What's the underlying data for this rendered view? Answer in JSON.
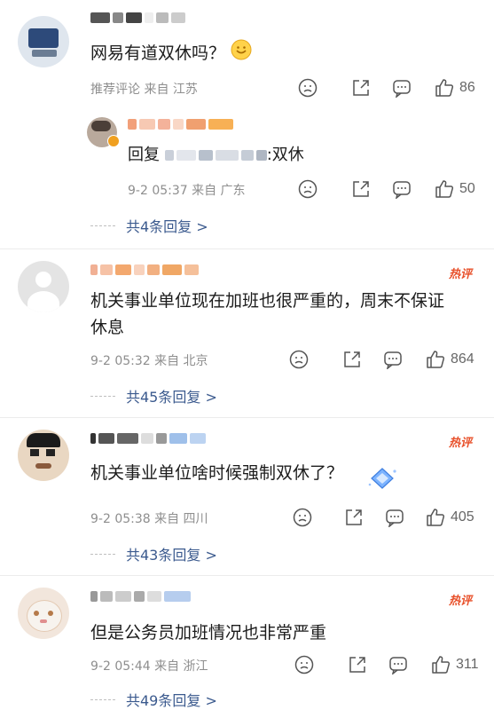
{
  "colors": {
    "accent_link": "#3b5a8e",
    "meta_gray": "#8e8e8e",
    "hot_badge": "#e8502a",
    "divider": "#ececec"
  },
  "comments": [
    {
      "text": "网易有道双休吗？",
      "meta": "推荐评论 来自 江苏",
      "likes": "86",
      "has_emoji": true,
      "reply": {
        "text": "回复",
        "text_suffix": ":双休",
        "meta": "9-2 05:37 来自 广东",
        "likes": "50"
      },
      "replies_label": "共4条回复 >"
    },
    {
      "badge": "热评",
      "text_line1": "机关事业单位现在加班也很严重的，周末不保证",
      "text_line2": "休息",
      "meta": "9-2 05:32 来自 北京",
      "likes": "864",
      "replies_label": "共45条回复 >"
    },
    {
      "badge": "热评",
      "text": "机关事业单位啥时候强制双休了？",
      "meta": "9-2 05:38 来自 四川",
      "likes": "405",
      "replies_label": "共43条回复 >"
    },
    {
      "badge": "热评",
      "text": "但是公务员加班情况也非常严重",
      "meta": "9-2 05:44 来自 浙江",
      "likes": "311",
      "replies_label": "共49条回复 >"
    }
  ],
  "icons": [
    "dislike-face-icon",
    "share-icon",
    "comment-icon",
    "thumbs-up-icon",
    "smile-emoji-icon",
    "diamond-sticker-icon"
  ]
}
